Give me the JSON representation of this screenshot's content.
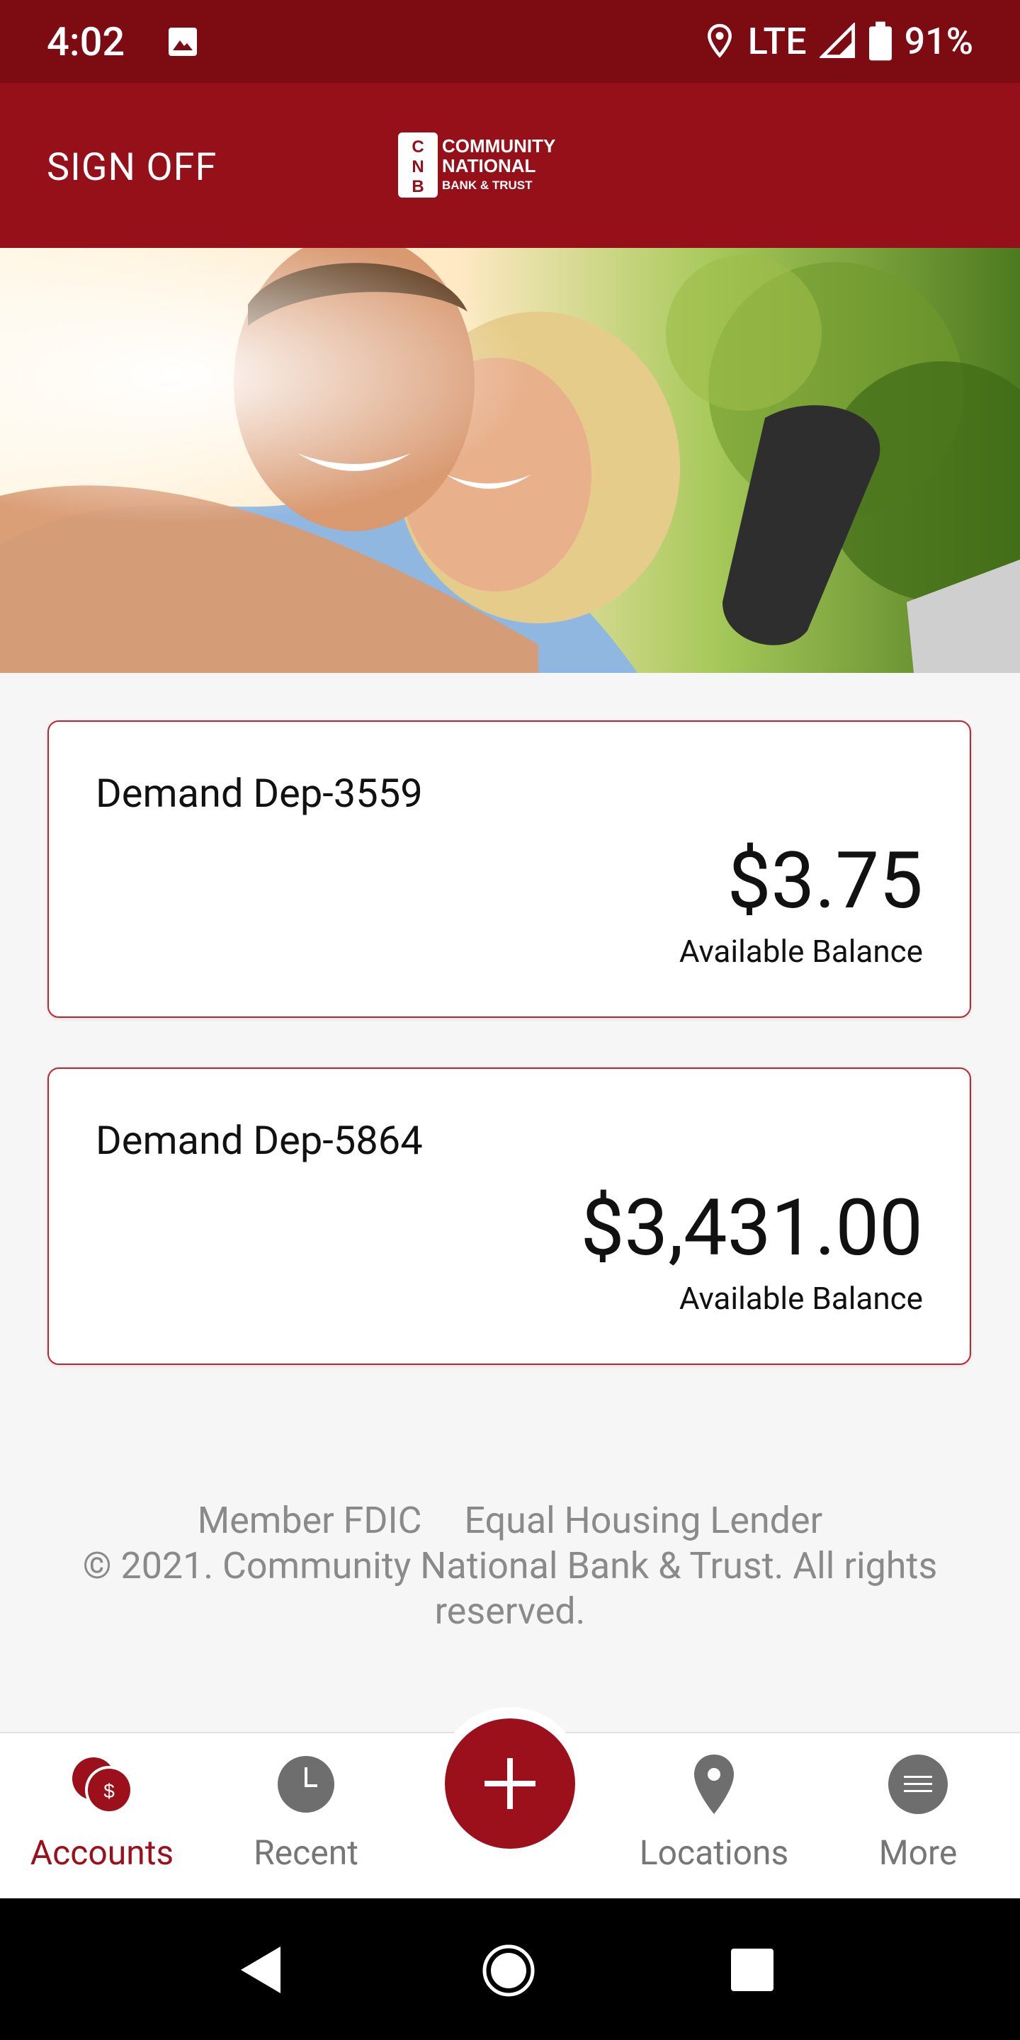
{
  "status_bar": {
    "time": "4:02",
    "network": "LTE",
    "battery": "91%"
  },
  "header": {
    "sign_off": "SIGN OFF",
    "logo": {
      "letters": "CNB",
      "line1": "COMMUNITY",
      "line2": "NATIONAL",
      "line3": "BANK & TRUST"
    }
  },
  "accounts": [
    {
      "name": "Demand Dep-3559",
      "balance": "$3.75",
      "balance_label": "Available Balance"
    },
    {
      "name": "Demand Dep-5864",
      "balance": "$3,431.00",
      "balance_label": "Available Balance"
    }
  ],
  "footer": {
    "fdic": "Member FDIC",
    "housing": "Equal Housing Lender",
    "copyright": "© 2021. Community National Bank & Trust. All rights reserved."
  },
  "nav": [
    {
      "label": "Accounts",
      "icon": "accounts-dollar-icon",
      "active": true
    },
    {
      "label": "Recent",
      "icon": "clock-icon"
    },
    {
      "label": "",
      "icon": "plus-icon"
    },
    {
      "label": "Locations",
      "icon": "map-pin-icon"
    },
    {
      "label": "More",
      "icon": "menu-icon"
    }
  ],
  "colors": {
    "brand": "#951019",
    "status_bar": "#7c0b12",
    "accent": "#9c101c",
    "card_border": "#c8212b"
  }
}
